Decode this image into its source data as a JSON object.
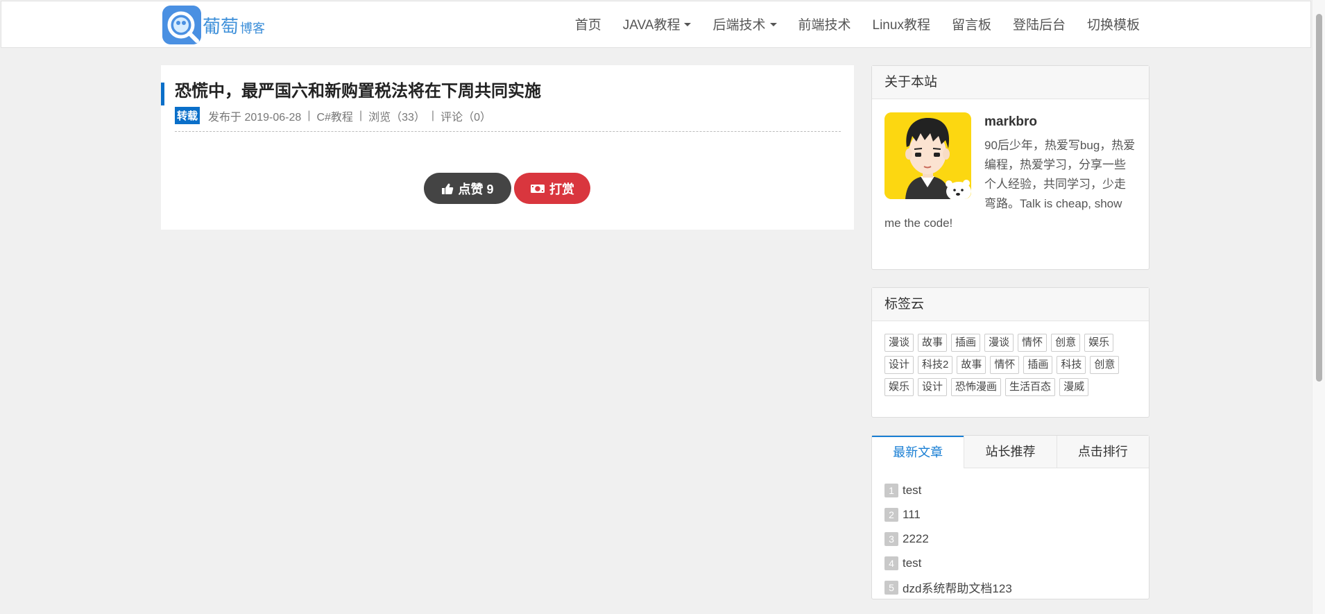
{
  "brand": {
    "name": "葡萄",
    "suffix": "博客"
  },
  "nav": {
    "items": [
      {
        "label": "首页",
        "has_caret": false
      },
      {
        "label": "JAVA教程",
        "has_caret": true
      },
      {
        "label": "后端技术",
        "has_caret": true
      },
      {
        "label": "前端技术",
        "has_caret": false
      },
      {
        "label": "Linux教程",
        "has_caret": false
      },
      {
        "label": "留言板",
        "has_caret": false
      },
      {
        "label": "登陆后台",
        "has_caret": false
      },
      {
        "label": "切换模板",
        "has_caret": false
      }
    ]
  },
  "article": {
    "title": "恐慌中，最严国六和新购置税法将在下周共同实施",
    "badge": "转载",
    "published": "发布于 2019-06-28",
    "category": "C#教程",
    "views": "浏览（33）",
    "comments": "评论（0）",
    "like_label": "点赞 9",
    "reward_label": "打赏"
  },
  "about": {
    "heading": "关于本站",
    "name": "markbro",
    "bio": "90后少年，热爱写bug，热爱编程，热爱学习，分享一些个人经验，共同学习，少走弯路。Talk is cheap, show me the code!"
  },
  "tag_cloud": {
    "heading": "标签云",
    "tags": [
      "漫谈",
      "故事",
      "插画",
      "漫谈",
      "情怀",
      "创意",
      "娱乐",
      "设计",
      "科技2",
      "故事",
      "情怀",
      "插画",
      "科技",
      "创意",
      "娱乐",
      "设计",
      "恐怖漫画",
      "生活百态",
      "漫威"
    ]
  },
  "recent": {
    "tabs": [
      "最新文章",
      "站长推荐",
      "点击排行"
    ],
    "active_tab": 0,
    "items": [
      {
        "num": "1",
        "title": "test"
      },
      {
        "num": "2",
        "title": "111"
      },
      {
        "num": "3",
        "title": "2222"
      },
      {
        "num": "4",
        "title": "test"
      },
      {
        "num": "5",
        "title": "dzd系统帮助文档123"
      }
    ]
  },
  "colors": {
    "accent": "#0a6fc9",
    "like_button": "#444444",
    "reward_button": "#d9363e",
    "avatar_bg": "#fcd711"
  }
}
